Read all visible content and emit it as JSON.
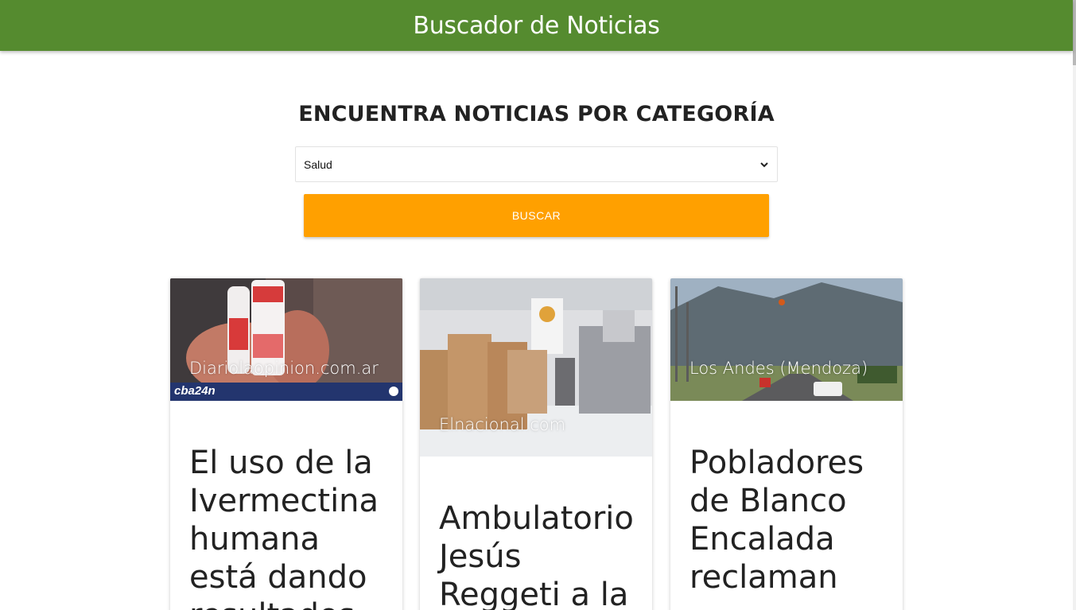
{
  "navbar": {
    "title": "Buscador de Noticias",
    "color": "#558b2f"
  },
  "main": {
    "heading": "ENCUENTRA NOTICIAS POR CATEGORÍA",
    "category_select": {
      "selected": "Salud",
      "icon": "chevron-down-icon"
    },
    "search_button": {
      "label": "BUSCAR",
      "color": "#ffa000"
    }
  },
  "cards": [
    {
      "source": "Diariolaopinion.com.ar",
      "image_badge": "cba24n",
      "title": "El uso de la Ivermectina humana está dando resultados"
    },
    {
      "source": "Elnacional.com",
      "title": "Ambulatorio Jesús Reggeti a la"
    },
    {
      "source": "Los Andes (Mendoza)",
      "title": "Pobladores de Blanco Encalada reclaman"
    }
  ]
}
